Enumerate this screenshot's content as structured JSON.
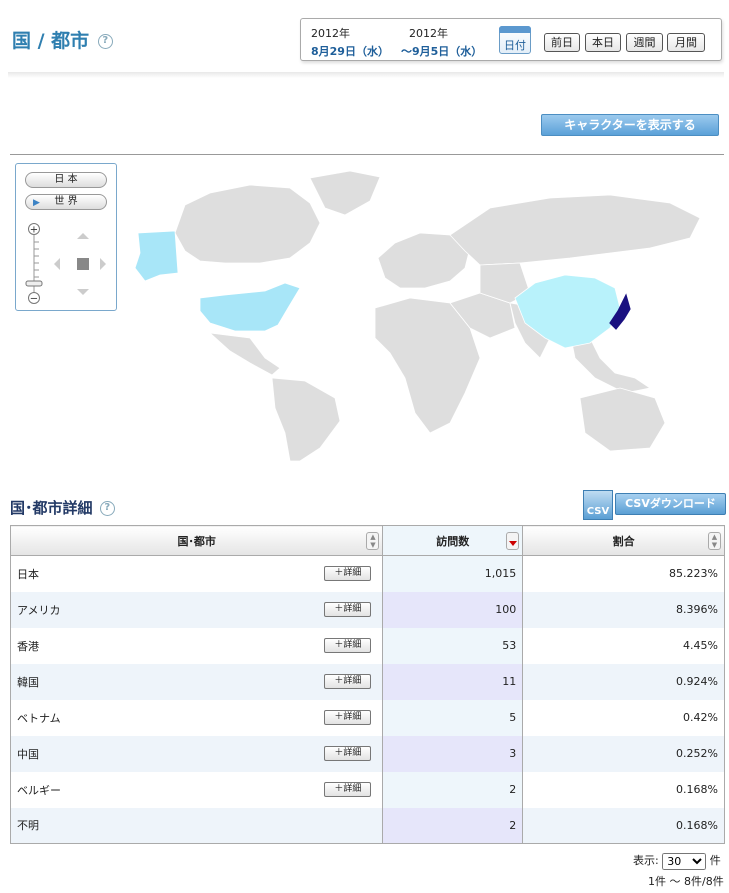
{
  "header": {
    "title": "国 / 都市",
    "help": "?"
  },
  "date_range": {
    "start_year": "2012年",
    "start_date": "8月29日（水）",
    "end_year": "2012年",
    "end_date": "～9月5日（水）",
    "calendar_label": "日付",
    "buttons": [
      "前日",
      "本日",
      "週間",
      "月間"
    ]
  },
  "character_button": "キャラクターを表示する",
  "map": {
    "buttons": [
      "日 本",
      "世 界"
    ],
    "colors": {
      "japan": "#1a1080",
      "usa_china": "#a8e6f8",
      "land": "#dedede",
      "border": "#ffffff"
    }
  },
  "section": {
    "title": "国･都市詳細",
    "help": "?",
    "csv_icon": "CSV",
    "csv_button": "CSVダウンロード"
  },
  "table": {
    "headers": [
      "国･都市",
      "訪問数",
      "割合"
    ],
    "detail_label": "＋詳細",
    "rows": [
      {
        "name": "日本",
        "visits": "1,015",
        "ratio": "85.223%",
        "detail": true
      },
      {
        "name": "アメリカ",
        "visits": "100",
        "ratio": "8.396%",
        "detail": true
      },
      {
        "name": "香港",
        "visits": "53",
        "ratio": "4.45%",
        "detail": true
      },
      {
        "name": "韓国",
        "visits": "11",
        "ratio": "0.924%",
        "detail": true
      },
      {
        "name": "ベトナム",
        "visits": "5",
        "ratio": "0.42%",
        "detail": true
      },
      {
        "name": "中国",
        "visits": "3",
        "ratio": "0.252%",
        "detail": true
      },
      {
        "name": "ベルギー",
        "visits": "2",
        "ratio": "0.168%",
        "detail": true
      },
      {
        "name": "不明",
        "visits": "2",
        "ratio": "0.168%",
        "detail": false
      }
    ]
  },
  "pager": {
    "display_label": "表示:",
    "per_page": "30",
    "unit": "件",
    "range": "1件 ～ 8件/8件"
  }
}
